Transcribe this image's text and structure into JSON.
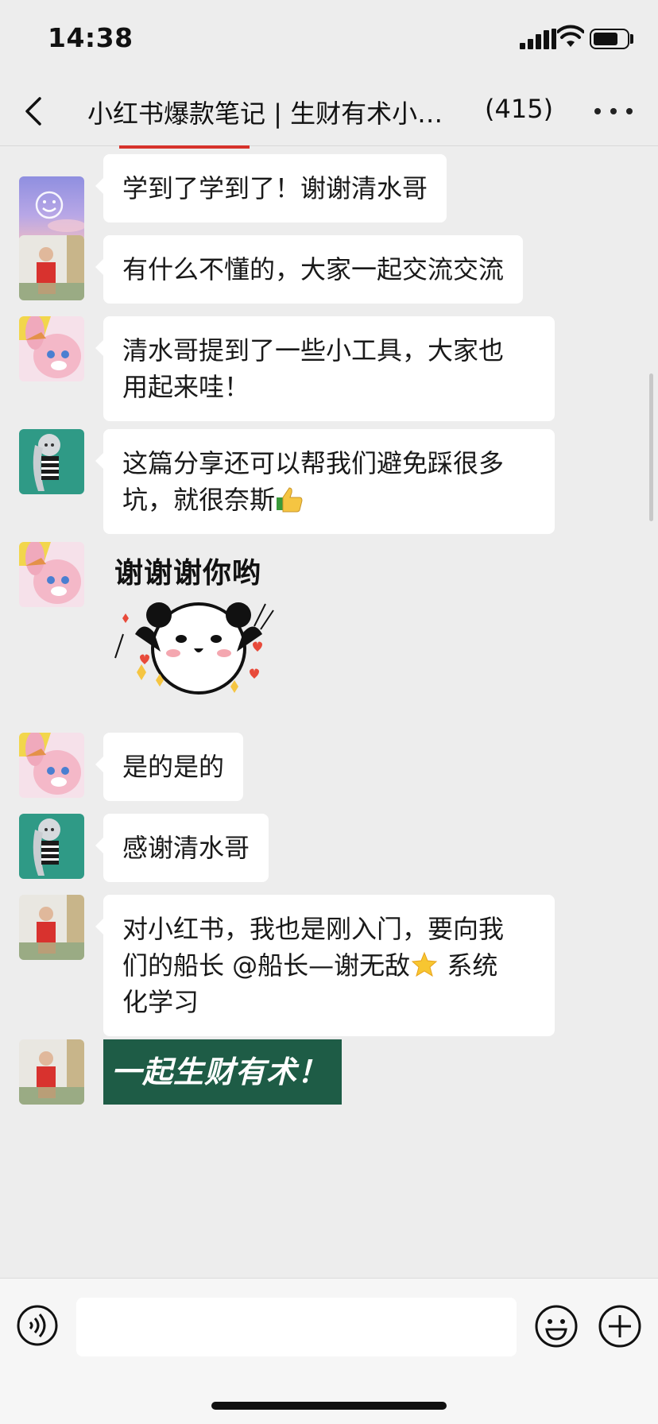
{
  "status": {
    "time": "14:38"
  },
  "header": {
    "title": "小红书爆款笔记 | 生财有术小…",
    "count": "(415)"
  },
  "messages": [
    {
      "text": "学到了学到了！谢谢清水哥"
    },
    {
      "text": "有什么不懂的，大家一起交流交流"
    },
    {
      "line1": "清水哥提到了一些小工具，大家也",
      "line2": "用起来哇！"
    },
    {
      "line1": "这篇分享还可以帮我们避免踩很多",
      "line2": "坑，就很奈斯"
    },
    {
      "sticker_text": "谢谢谢你哟"
    },
    {
      "text": "是的是的"
    },
    {
      "text": "感谢清水哥"
    },
    {
      "line1": "对小红书，我也是刚入门，要向我",
      "line2a": "们的船长 @船长—谢无敌",
      "line2b": " 系统",
      "line3": "化学习"
    },
    {
      "banner": "一起生财有术！"
    }
  ],
  "input": {
    "placeholder": ""
  },
  "colors": {
    "background": "#ededed",
    "bubble": "#ffffff",
    "banner": "#1e5c46",
    "indicator": "#d6322b"
  }
}
